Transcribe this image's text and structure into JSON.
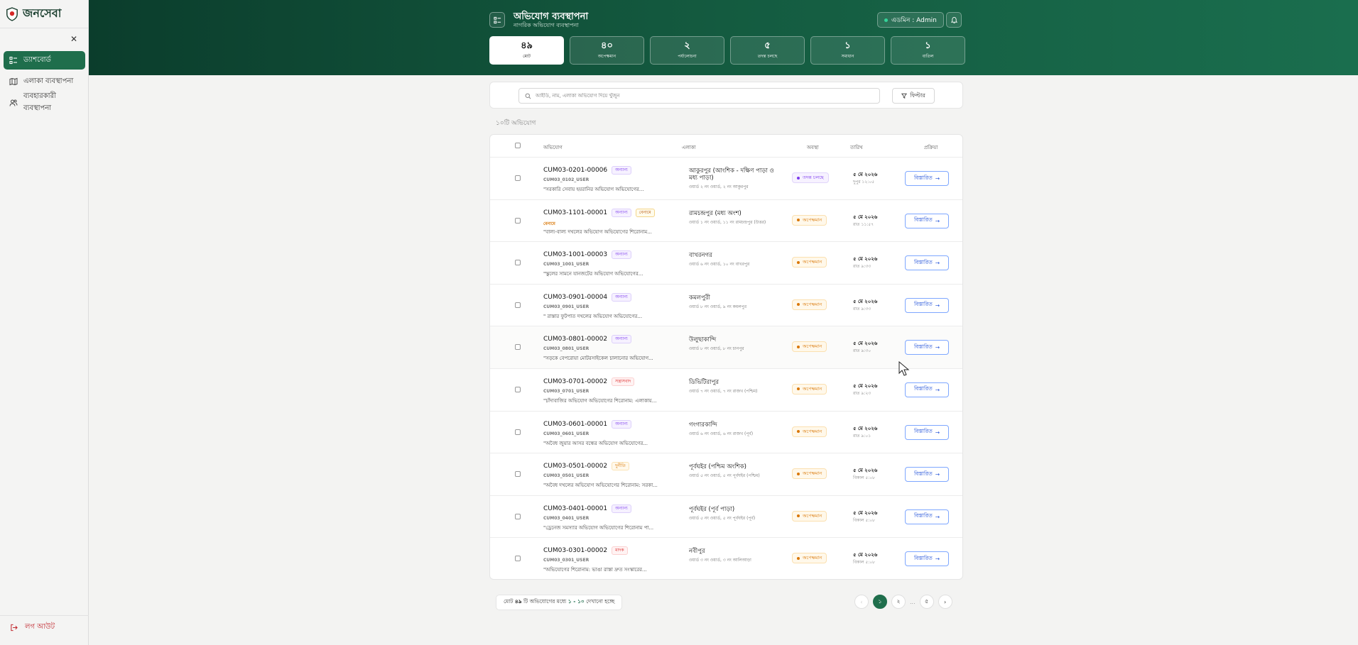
{
  "app": {
    "brand": "জনসেবা"
  },
  "sidebar": {
    "close": "✕",
    "items": [
      {
        "label": "ড্যাশবোর্ড",
        "icon": "dashboard-icon",
        "active": true
      },
      {
        "label": "এলাকা ব্যবস্থাপনা",
        "icon": "map-icon",
        "active": false
      },
      {
        "label": "ব্যবহারকারী ব্যবস্থাপনা",
        "icon": "users-icon",
        "active": false
      }
    ],
    "logout": "লগ আউট"
  },
  "header": {
    "title": "অভিযোগ ব্যবস্থাপনা",
    "subtitle": "নাগরিক অভিযোগ ব্যবস্থাপনা",
    "admin_label": "এডমিন : Admin"
  },
  "stats": [
    {
      "num": "৪৯",
      "label": "মোট",
      "active": true
    },
    {
      "num": "৪০",
      "label": "অপেক্ষমান"
    },
    {
      "num": "২",
      "label": "পর্যালোচনা"
    },
    {
      "num": "৫",
      "label": "তদন্ত চলছে"
    },
    {
      "num": "১",
      "label": "সমাধান"
    },
    {
      "num": "১",
      "label": "বাতিল"
    }
  ],
  "search": {
    "placeholder": "আইডি, নাম, এলাকা অভিযোগ দিয়ে খুঁজুন",
    "filter_label": "ফিল্টার"
  },
  "count_label": "১০টি অভিযোগ",
  "table": {
    "headers": {
      "complaint": "অভিযোগ",
      "area": "এলাকা",
      "status": "অবস্থা",
      "date": "তারিখ",
      "action": "প্রক্রিয়া"
    },
    "rows": [
      {
        "id": "CUM03-0201-00006",
        "tags": [
          {
            "text": "অন্যান্য",
            "color": "purple"
          }
        ],
        "user": "CUM03_0102_USER",
        "desc": "\"সরকারি সেবায় হয়রানির অভিযোগ অভিযোগের...",
        "area": "আকুরপুর (আংশিক - দক্ষিণ পাড়া ও মধ্য পাড়া)",
        "area_sub": "ওয়ার্ড ২ নং ওয়ার্ড, ২ নং আকুরপুর",
        "status": "তদন্ত চলছে",
        "status_type": "progress",
        "date": "৫ মে ২০২৬",
        "date_sub": "দুপুর ১২:০৫",
        "action": "বিস্তারিত"
      },
      {
        "id": "CUM03-1101-00001",
        "tags": [
          {
            "text": "অন্যান্য",
            "color": "purple"
          },
          {
            "text": "বেনামে",
            "color": "amber"
          }
        ],
        "user": "বেনামে",
        "desc": "\"বাল্য-বাল্য দখলের অভিযোগ অভিযোগের শিরোনাম...",
        "area": "রামচন্দ্রপুর (মধ্য অংশ)",
        "area_sub": "ওয়ার্ড ১ নং ওয়ার্ড, ১১ নং রামচন্দ্রপুর (উত্তর)",
        "status": "অপেক্ষমান",
        "status_type": "pending",
        "date": "৫ মে ২০২৬",
        "date_sub": "রাত ১১:৫৭",
        "action": "বিস্তারিত"
      },
      {
        "id": "CUM03-1001-00003",
        "tags": [
          {
            "text": "অন্যান্য",
            "color": "purple"
          }
        ],
        "user": "CUM03_1001_USER",
        "desc": "\"স্কুলের সামনে যানজটের অভিযোগ অভিযোগের...",
        "area": "বাখরনগর",
        "area_sub": "ওয়ার্ড ৬ নং ওয়ার্ড, ১০ নং বাখরপুর",
        "status": "অপেক্ষমান",
        "status_type": "pending",
        "date": "৫ মে ২০২৬",
        "date_sub": "রাত ৯:৩৩",
        "action": "বিস্তারিত"
      },
      {
        "id": "CUM03-0901-00004",
        "tags": [
          {
            "text": "অন্যান্য",
            "color": "purple"
          }
        ],
        "user": "CUM03_0901_USER",
        "desc": "\" রাস্তার ফুটপাত দখলের অভিযোগ অভিযোগের...",
        "area": "কমলপুরী",
        "area_sub": "ওয়ার্ড ৮ নং ওয়ার্ড, ৯ নং কমলপুর",
        "status": "অপেক্ষমান",
        "status_type": "pending",
        "date": "৫ মে ২০২৬",
        "date_sub": "রাত ৯:৩৩",
        "action": "বিস্তারিত"
      },
      {
        "id": "CUM03-0801-00002",
        "tags": [
          {
            "text": "অন্যান্য",
            "color": "purple"
          }
        ],
        "user": "CUM03_0801_USER",
        "desc": "\"সড়কে বেপরোয়া মোটরসাইকেল চালানোর অভিযোগ...",
        "area": "উলুছাকান্দি",
        "area_sub": "ওয়ার্ড ৮ নং ওয়ার্ড, ৮ নং চানপুর",
        "status": "অপেক্ষমান",
        "status_type": "pending",
        "date": "৫ মে ২০২৬",
        "date_sub": "রাত ৯:৩০",
        "action": "বিস্তারিত"
      },
      {
        "id": "CUM03-0701-00002",
        "tags": [
          {
            "text": "সন্ত্রাসবাদ",
            "color": "red"
          }
        ],
        "user": "CUM03_0701_USER",
        "desc": "\"চাঁদাবাজির অভিযোগ অভিযোগের শিরোনাম: এলাকায়...",
        "area": "ডিভিটিরাপুর",
        "area_sub": "ওয়ার্ড ৭ নং ওয়ার্ড, ৭ নং রাজখ (পশ্চিম)",
        "status": "অপেক্ষমান",
        "status_type": "pending",
        "date": "৫ মে ২০২৬",
        "date_sub": "রাত ৯:২৩",
        "action": "বিস্তারিত"
      },
      {
        "id": "CUM03-0601-00001",
        "tags": [
          {
            "text": "অন্যান্য",
            "color": "purple"
          }
        ],
        "user": "CUM03_0601_USER",
        "desc": "\"অবৈধ জুয়ার আসর বন্ধের অভিযোগ অভিযোগের...",
        "area": "গংগারকান্দি",
        "area_sub": "ওয়ার্ড ৬ নং ওয়ার্ড, ৬ নং রাজখ (পূর্ব)",
        "status": "অপেক্ষমান",
        "status_type": "pending",
        "date": "৫ মে ২০২৬",
        "date_sub": "রাত ৯:০১",
        "action": "বিস্তারিত"
      },
      {
        "id": "CUM03-0501-00002",
        "tags": [
          {
            "text": "দুর্নীতি",
            "color": "orange"
          }
        ],
        "user": "CUM03_0501_USER",
        "desc": "\"অবৈধ দখলের অভিযোগ অভিযোগের শিরোনাম: সরকা...",
        "area": "পূর্বঘইর (পশ্চিম অংশিক)",
        "area_sub": "ওয়ার্ড ৫ নং ওয়ার্ড, ৫ নং পূর্বঘইর (পশ্চিম)",
        "status": "অপেক্ষমান",
        "status_type": "pending",
        "date": "৫ মে ২০২৬",
        "date_sub": "বিকাল ৫:০৮",
        "action": "বিস্তারিত"
      },
      {
        "id": "CUM03-0401-00001",
        "tags": [
          {
            "text": "অন্যান্য",
            "color": "purple"
          }
        ],
        "user": "CUM03_0401_USER",
        "desc": "\"ড্রেনেজ সমস্যার অভিযোগ অভিযোগের শিরোনাম পা...",
        "area": "পূর্বঘইর (পূর্ব পাড়া)",
        "area_sub": "ওয়ার্ড ৫ নং ওয়ার্ড, ৫ নং পূর্বঘইর (পূর্ব)",
        "status": "অপেক্ষমান",
        "status_type": "pending",
        "date": "৫ মে ২০২৬",
        "date_sub": "বিকাল ৫:০৮",
        "action": "বিস্তারিত"
      },
      {
        "id": "CUM03-0301-00002",
        "tags": [
          {
            "text": "মাদক",
            "color": "red"
          }
        ],
        "user": "CUM03_0301_USER",
        "desc": "\"অভিযোগের শিরোনাম: ভাঙা রাস্তা দ্রুত সংস্কারের...",
        "area": "নবীপুর",
        "area_sub": "ওয়ার্ড ৩ নং ওয়ার্ড, ৩ নং আলিআড়া",
        "status": "অপেক্ষমান",
        "status_type": "pending",
        "date": "৫ মে ২০২৬",
        "date_sub": "বিকাল ৫:০৮",
        "action": "বিস্তারিত"
      }
    ]
  },
  "footer": {
    "summary_pre": "মোট",
    "summary_total": "৪৯",
    "summary_mid": "টি অভিযোগের মধ্যে",
    "summary_range": "১ - ১০",
    "summary_post": "দেখানো হচ্ছে",
    "pages": [
      "১",
      "২",
      "...",
      "৫"
    ],
    "prev": "‹",
    "next": "›"
  },
  "colors": {
    "primary": "#1f6e4c",
    "banner_dark": "#0b3d2c",
    "pending": "#d97706",
    "progress": "#7c3aed",
    "action": "#1d4ed8",
    "logout": "#c0262d"
  }
}
